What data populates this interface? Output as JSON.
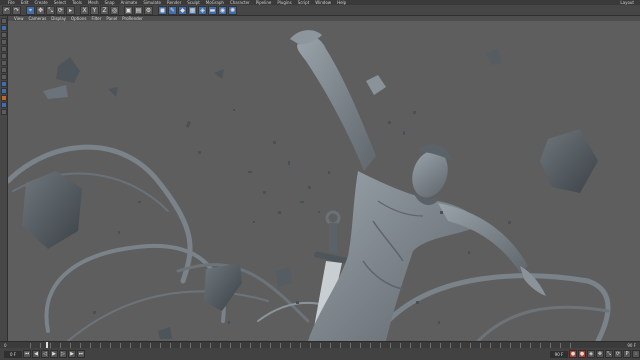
{
  "menubar": {
    "items": [
      "File",
      "Edit",
      "Create",
      "Select",
      "Tools",
      "Mesh",
      "Snap",
      "Animate",
      "Simulate",
      "Render",
      "Sculpt",
      "MoGraph",
      "Character",
      "Pipeline",
      "Plugins",
      "Script",
      "Window",
      "Help"
    ],
    "layout_label": "Layout"
  },
  "toolbar": {
    "buttons": [
      {
        "icon": "undo-icon",
        "glyph": "↶"
      },
      {
        "icon": "redo-icon",
        "glyph": "↷"
      },
      {
        "icon": "live-selection-icon",
        "glyph": "⌖",
        "style": "blue"
      },
      {
        "icon": "move-icon",
        "glyph": "✥"
      },
      {
        "icon": "scale-icon",
        "glyph": "⤡"
      },
      {
        "icon": "rotate-icon",
        "glyph": "⟳"
      },
      {
        "icon": "recent-tools-icon",
        "glyph": "▸"
      },
      {
        "icon": "x-axis-icon",
        "glyph": "X"
      },
      {
        "icon": "y-axis-icon",
        "glyph": "Y"
      },
      {
        "icon": "z-axis-icon",
        "glyph": "Z"
      },
      {
        "icon": "coordinate-system-icon",
        "glyph": "◎"
      },
      {
        "icon": "render-view-icon",
        "glyph": "▣"
      },
      {
        "icon": "render-picture-viewer-icon",
        "glyph": "▤"
      },
      {
        "icon": "render-settings-icon",
        "glyph": "⚙"
      },
      {
        "icon": "cube-icon",
        "glyph": "◼",
        "style": "blue"
      },
      {
        "icon": "spline-pen-icon",
        "glyph": "✎",
        "style": "blue"
      },
      {
        "icon": "subdivision-icon",
        "glyph": "◆",
        "style": "blue"
      },
      {
        "icon": "array-icon",
        "glyph": "▦",
        "style": "blue"
      },
      {
        "icon": "deformer-icon",
        "glyph": "◈",
        "style": "blue"
      },
      {
        "icon": "floor-icon",
        "glyph": "▬",
        "style": "blue"
      },
      {
        "icon": "camera-icon",
        "glyph": "◉",
        "style": "blue"
      },
      {
        "icon": "light-icon",
        "glyph": "✺",
        "style": "blue"
      }
    ]
  },
  "leftbar": {
    "buttons": [
      {
        "icon": "make-editable-icon",
        "style": ""
      },
      {
        "icon": "model-mode-icon",
        "style": "blue"
      },
      {
        "icon": "texture-mode-icon",
        "style": ""
      },
      {
        "icon": "workplane-icon",
        "style": ""
      },
      {
        "icon": "points-mode-icon",
        "style": ""
      },
      {
        "icon": "edges-mode-icon",
        "style": ""
      },
      {
        "icon": "polygons-mode-icon",
        "style": ""
      },
      {
        "icon": "axis-mode-icon",
        "style": ""
      },
      {
        "icon": "tweak-mode-icon",
        "style": ""
      },
      {
        "icon": "snap-icon",
        "style": "blue"
      },
      {
        "icon": "workplane-lock-icon",
        "style": "blue"
      },
      {
        "icon": "grid-icon",
        "style": "orange"
      },
      {
        "icon": "quantize-icon",
        "style": "blue"
      },
      {
        "icon": "solo-icon",
        "style": ""
      }
    ]
  },
  "viewport_menu": {
    "items": [
      "View",
      "Cameras",
      "Display",
      "Options",
      "Filter",
      "Panel",
      "ProRender"
    ]
  },
  "timeline": {
    "start_frame": "0",
    "end_frame": "90 F"
  },
  "transport": {
    "current_frame": "0 F",
    "end_frame": "90 F",
    "buttons": [
      {
        "icon": "go-to-start-icon",
        "glyph": "⏮"
      },
      {
        "icon": "previous-key-icon",
        "glyph": "◀"
      },
      {
        "icon": "previous-frame-icon",
        "glyph": "◁"
      },
      {
        "icon": "play-icon",
        "glyph": "▶"
      },
      {
        "icon": "next-frame-icon",
        "glyph": "▷"
      },
      {
        "icon": "next-key-icon",
        "glyph": "▶"
      },
      {
        "icon": "go-to-end-icon",
        "glyph": "⏭"
      }
    ],
    "right_buttons": [
      {
        "icon": "record-icon",
        "glyph": "●",
        "style": "red"
      },
      {
        "icon": "autokey-icon",
        "glyph": "●",
        "style": "red"
      },
      {
        "icon": "keyframe-selection-icon",
        "glyph": "◈"
      },
      {
        "icon": "position-key-icon",
        "glyph": "✥"
      },
      {
        "icon": "scale-key-icon",
        "glyph": "⤡"
      },
      {
        "icon": "rotation-key-icon",
        "glyph": "⟳"
      },
      {
        "icon": "parameter-key-icon",
        "glyph": "P"
      },
      {
        "icon": "point-level-key-icon",
        "glyph": "⁘"
      }
    ]
  },
  "scene": {
    "background": "#5e5e5e",
    "model_color": "#7f8890",
    "model_shadow": "#4b5157"
  }
}
